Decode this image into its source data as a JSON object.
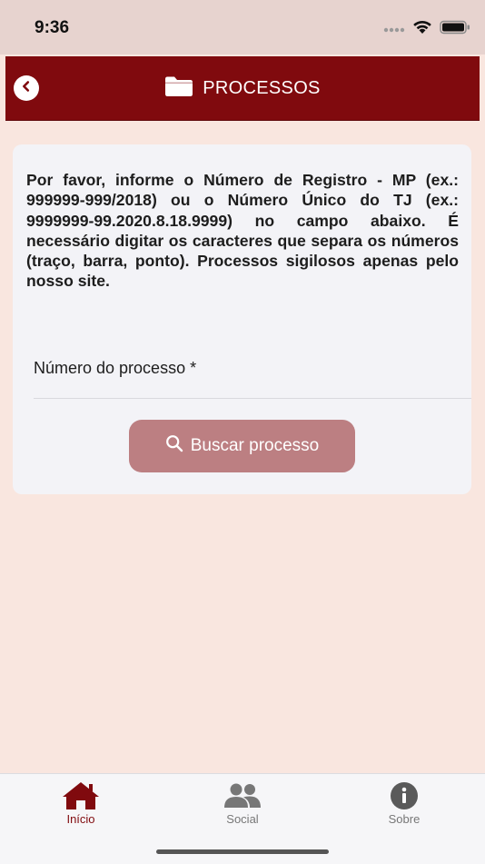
{
  "status_bar": {
    "time": "9:36"
  },
  "header": {
    "title": "PROCESSOS",
    "back_icon": "chevron-left-icon",
    "title_icon": "folder-icon"
  },
  "main": {
    "instructions": "Por favor, informe o Número de Registro - MP (ex.: 999999-999/2018) ou o Número Único do TJ (ex.: 9999999-99.2020.8.18.9999) no campo abaixo. É necessário digitar os caracteres que separa os números (traço, barra, ponto). Processos sigilosos apenas pelo nosso site.",
    "process_field": {
      "label": "Número do processo *",
      "value": ""
    },
    "search_button": {
      "label": "Buscar processo",
      "icon": "search-icon"
    }
  },
  "tabbar": {
    "items": [
      {
        "label": "Início",
        "icon": "home-icon",
        "active": true
      },
      {
        "label": "Social",
        "icon": "people-icon",
        "active": false
      },
      {
        "label": "Sobre",
        "icon": "info-icon",
        "active": false
      }
    ]
  },
  "colors": {
    "brand": "#800a0e",
    "background": "#f9e6df",
    "button": "#bc7f82",
    "tab_active": "#800a0e",
    "tab_inactive": "#777777"
  }
}
